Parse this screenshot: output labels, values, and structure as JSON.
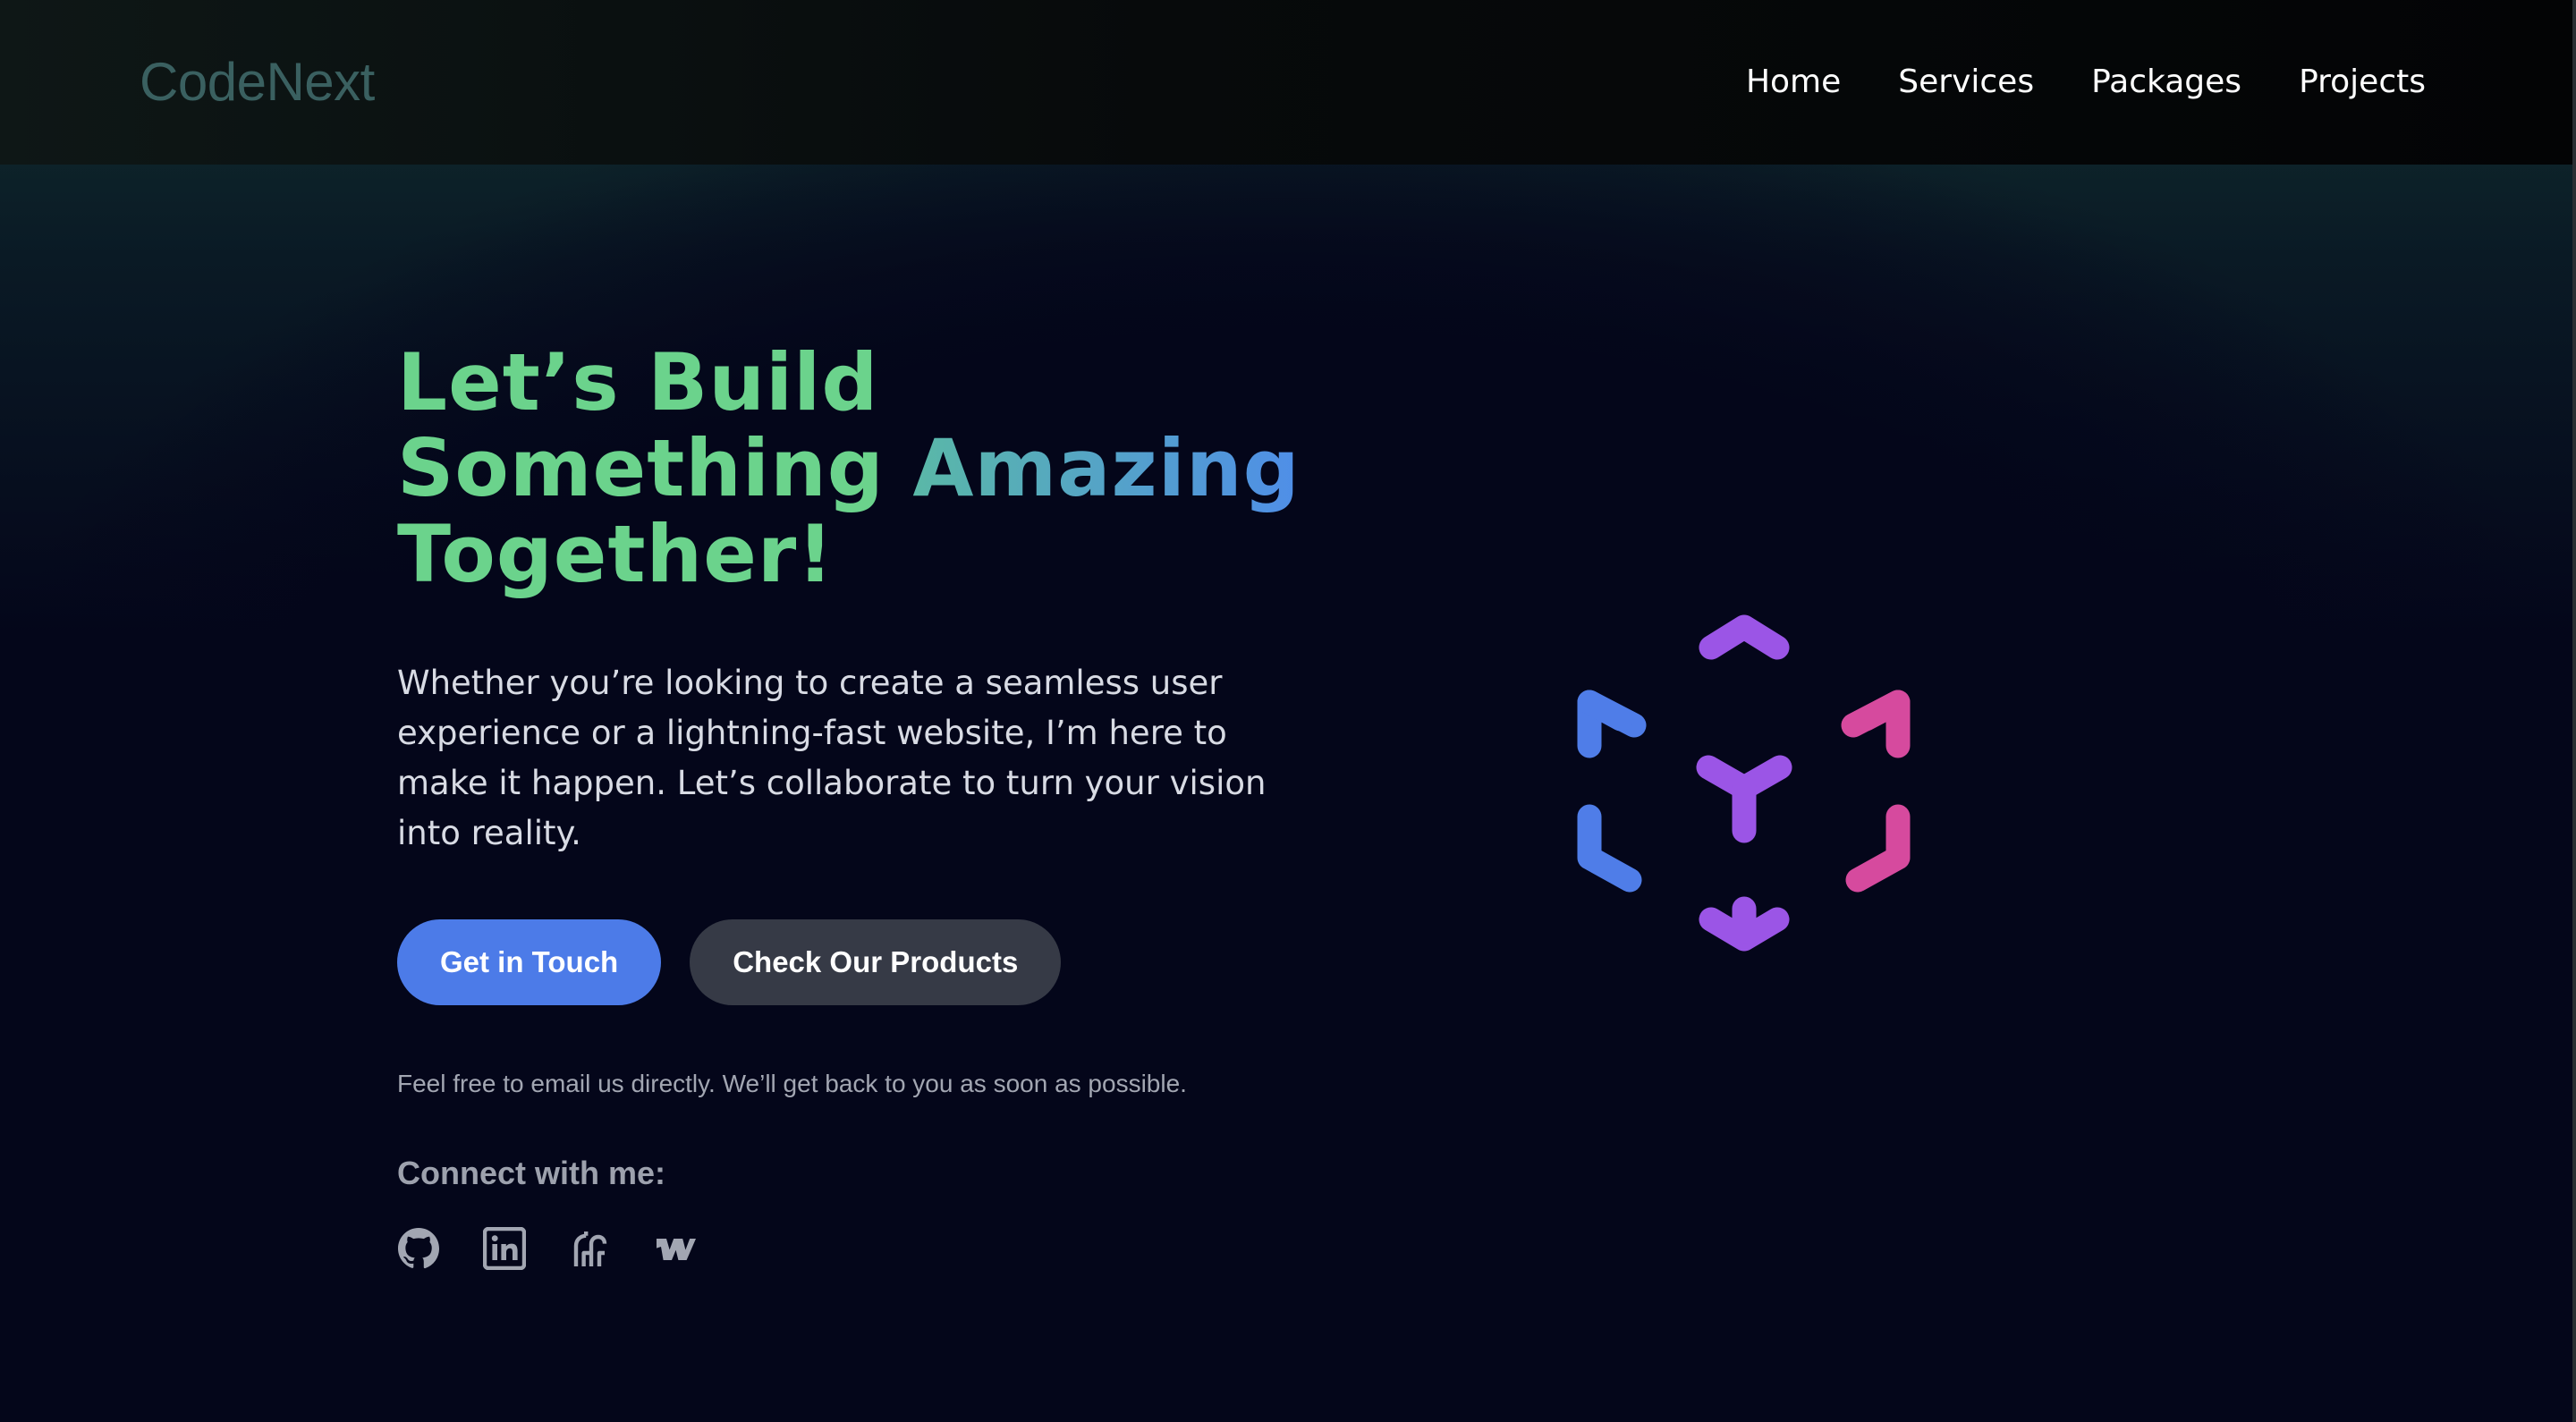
{
  "brand": {
    "name": "CodeNext"
  },
  "nav": {
    "items": [
      {
        "label": "Home"
      },
      {
        "label": "Services"
      },
      {
        "label": "Packages"
      },
      {
        "label": "Projects"
      }
    ]
  },
  "hero": {
    "headline_line1": "Let’s Build",
    "headline_line2_a": "Something ",
    "headline_line2_b": "Amazing",
    "headline_line3": "Together!",
    "description": "Whether you’re looking to create a seamless user experience or a lightning-fast website, I’m here to make it happen. Let’s collaborate to turn your vision into reality.",
    "primary_button": "Get in Touch",
    "secondary_button": "Check Our Products",
    "note": "Feel free to email us directly. We’ll get back to you as soon as possible.",
    "connect_label": "Connect with me:"
  },
  "socials": [
    {
      "icon": "github-icon"
    },
    {
      "icon": "linkedin-icon"
    },
    {
      "icon": "hashnode-icon"
    },
    {
      "icon": "webflow-icon"
    }
  ],
  "colors": {
    "background": "#04061a",
    "headline_green": "#6bd38c",
    "headline_blue": "#4f8ee8",
    "primary_button": "#4c7be8",
    "secondary_button": "#363a46",
    "mark_blue": "#4f7de8",
    "mark_purple": "#9b55e6",
    "mark_pink": "#d64a9e"
  }
}
